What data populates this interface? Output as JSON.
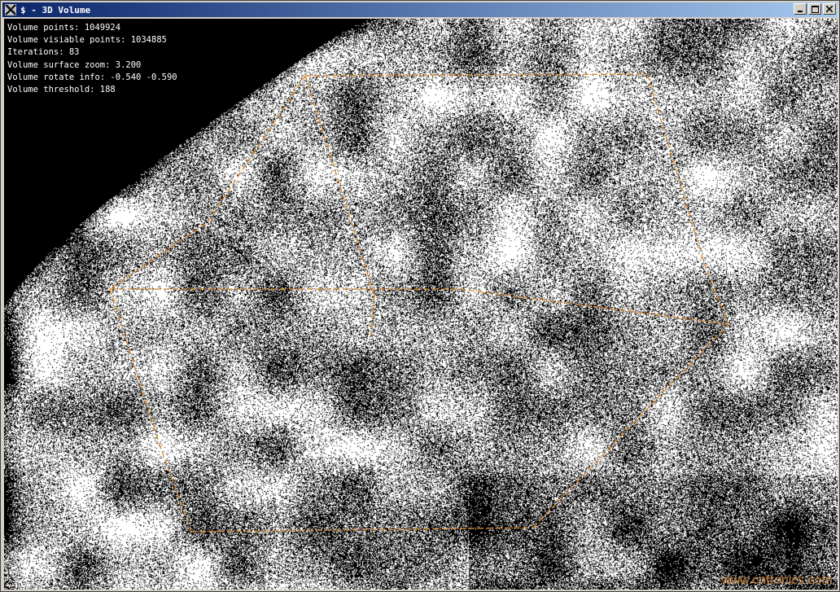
{
  "window": {
    "title": "$ - 3D Volume",
    "icon": "x-app-icon",
    "buttons": [
      "minimize-icon",
      "maximize-icon",
      "close-icon"
    ]
  },
  "info": {
    "lines": [
      "Volume points: 1049924",
      "Volume visiable points: 1034885",
      "Iterations: 83",
      "Volume surface zoom: 3.200",
      "Volume rotate info: -0.540 -0.590",
      "Volume threshold: 188"
    ]
  },
  "render": {
    "noise_colors": [
      "#ffffff",
      "#000000"
    ],
    "wireframe_color": "#e08a2c"
  },
  "watermark": {
    "text": "www.cntronics.com"
  }
}
